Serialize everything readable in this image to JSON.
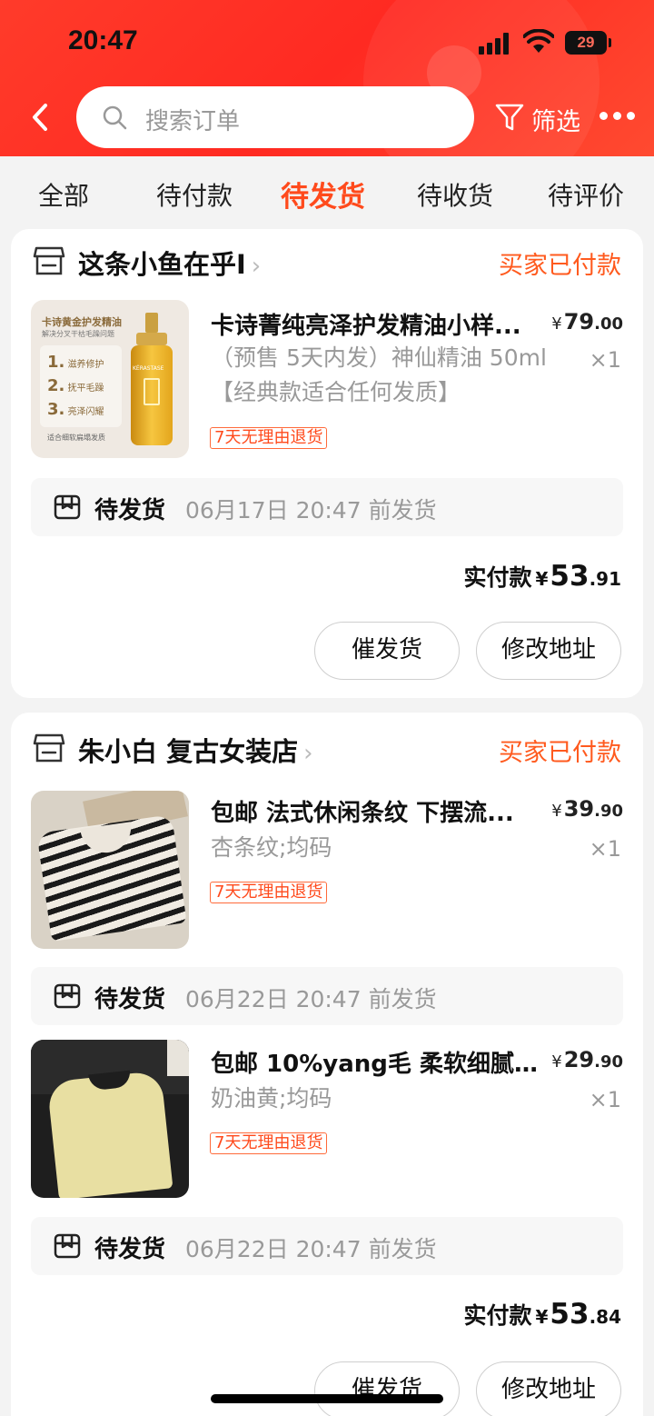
{
  "status_bar": {
    "time": "20:47",
    "battery": "29"
  },
  "header": {
    "search_placeholder": "搜索订单",
    "filter_label": "筛选"
  },
  "tabs": [
    {
      "label": "全部"
    },
    {
      "label": "待付款"
    },
    {
      "label": "待发货",
      "active": true
    },
    {
      "label": "待收货"
    },
    {
      "label": "待评价"
    }
  ],
  "orders": [
    {
      "shop_name": "这条小鱼在乎I",
      "status": "买家已付款",
      "items": [
        {
          "title": "卡诗菁纯亮泽护发精油小样...",
          "price_yen": "¥",
          "price_int": "79",
          "price_dec": ".00",
          "sku": "（预售 5天内发）神仙精油 50ml【经典款适合任何发质】",
          "qty": "×1",
          "tag": "7天无理由退货",
          "thumb_text": {
            "t1": "卡诗黄金护发精油",
            "t2": "解决分叉干枯毛躁问题",
            "l1": "滋养修护",
            "l2": "抚平毛躁",
            "l3": "亮泽闪耀",
            "foot": "适合细软扁塌发质",
            "brand": "KÉRASTASE"
          },
          "shipping_label": "待发货",
          "shipping_time": "06月17日 20:47 前发货"
        }
      ],
      "total_label": "实付款",
      "total_yen": "¥",
      "total_int": "53",
      "total_dec": ".91",
      "buttons": [
        "催发货",
        "修改地址"
      ]
    },
    {
      "shop_name": "朱小白 复古女装店",
      "status": "买家已付款",
      "items": [
        {
          "title": "包邮 法式休闲条纹 下摆流...",
          "price_yen": "¥",
          "price_int": "39",
          "price_dec": ".90",
          "sku": "杏条纹;均码",
          "qty": "×1",
          "tag": "7天无理由退货",
          "shipping_label": "待发货",
          "shipping_time": "06月22日 20:47 前发货"
        },
        {
          "title": "包邮 10%yang毛 柔软细腻1...",
          "price_yen": "¥",
          "price_int": "29",
          "price_dec": ".90",
          "sku": "奶油黄;均码",
          "qty": "×1",
          "tag": "7天无理由退货",
          "shipping_label": "待发货",
          "shipping_time": "06月22日 20:47 前发货"
        }
      ],
      "total_label": "实付款",
      "total_yen": "¥",
      "total_int": "53",
      "total_dec": ".84",
      "buttons": [
        "催发货",
        "修改地址"
      ]
    }
  ],
  "colors": {
    "brand_red": "#ff3b2a",
    "accent_orange": "#ff5a1e"
  }
}
